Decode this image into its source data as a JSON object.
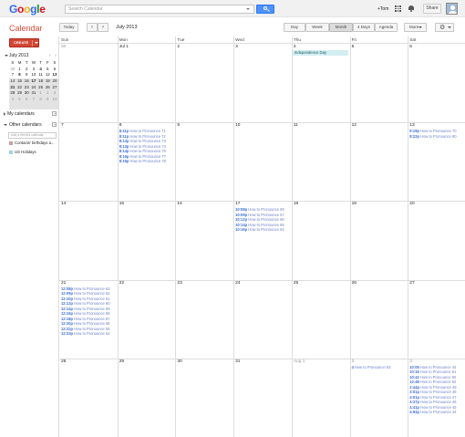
{
  "header": {
    "logo": [
      "G",
      "o",
      "o",
      "g",
      "l",
      "e"
    ],
    "logo_colors": [
      "#3369e8",
      "#d50f25",
      "#eeb211",
      "#3369e8",
      "#009925",
      "#d50f25"
    ],
    "search_placeholder": "Search Calendar",
    "user": "+Tom",
    "share_label": "Share"
  },
  "toolbar": {
    "app_title": "Calendar",
    "today_label": "Today",
    "prev_icon": "‹",
    "next_icon": "›",
    "date_range": "July 2013",
    "view_day": "Day",
    "view_week": "Week",
    "view_month": "Month",
    "view_4days": "4 Days",
    "view_agenda": "Agenda",
    "more_label": "More"
  },
  "sidebar": {
    "create_label": "CREATE",
    "mini_title": "July 2013",
    "mini_prev": "‹",
    "mini_next": "›",
    "mini_dow": [
      "S",
      "M",
      "T",
      "W",
      "T",
      "F",
      "S"
    ],
    "mini_weeks": [
      [
        "30",
        "1",
        "2",
        "3",
        "4",
        "5",
        "6"
      ],
      [
        "7",
        "8",
        "9",
        "10",
        "11",
        "12",
        "13"
      ],
      [
        "14",
        "15",
        "16",
        "17",
        "18",
        "19",
        "20"
      ],
      [
        "21",
        "22",
        "23",
        "24",
        "25",
        "26",
        "27"
      ],
      [
        "28",
        "29",
        "30",
        "31",
        "1",
        "2",
        "3"
      ],
      [
        "4",
        "5",
        "6",
        "7",
        "8",
        "9",
        "10"
      ]
    ],
    "my_calendars": "My calendars",
    "other_calendars": "Other calendars",
    "add_friend_placeholder": "Add a friend's calendar",
    "calendars": [
      {
        "name": "Contacts' birthdays a...",
        "color": "#c7a0a0"
      },
      {
        "name": "US Holidays",
        "color": "#9fd4e3"
      }
    ]
  },
  "month": {
    "dow": [
      "Sun",
      "Mon",
      "Tue",
      "Wed",
      "Thu",
      "Fri",
      "Sat"
    ],
    "weeks": [
      [
        {
          "day": "30",
          "other": true,
          "events": []
        },
        {
          "day": "Jul 1",
          "events": []
        },
        {
          "day": "2",
          "events": []
        },
        {
          "day": "3",
          "events": []
        },
        {
          "day": "4",
          "allday": "Independence Day",
          "events": []
        },
        {
          "day": "5",
          "events": []
        },
        {
          "day": "6",
          "events": []
        }
      ],
      [
        {
          "day": "7",
          "events": []
        },
        {
          "day": "8",
          "events": [
            {
              "time": "8:11p",
              "title": "How to Pronounce 71"
            },
            {
              "time": "8:11p",
              "title": "How to Pronounce 72"
            },
            {
              "time": "8:12p",
              "title": "How to Pronounce 73"
            },
            {
              "time": "8:13p",
              "title": "How to Pronounce 74"
            },
            {
              "time": "8:14p",
              "title": "How to Pronounce 75"
            },
            {
              "time": "8:15p",
              "title": "How to Pronounce 77"
            },
            {
              "time": "8:16p",
              "title": "How to Pronounce 78"
            }
          ]
        },
        {
          "day": "9",
          "events": []
        },
        {
          "day": "10",
          "events": []
        },
        {
          "day": "11",
          "events": []
        },
        {
          "day": "12",
          "events": []
        },
        {
          "day": "13",
          "events": [
            {
              "time": "8:19p",
              "title": "How to Pronounce 70"
            },
            {
              "time": "8:22p",
              "title": "How to Pronounce 80"
            }
          ]
        }
      ],
      [
        {
          "day": "14",
          "events": []
        },
        {
          "day": "15",
          "events": []
        },
        {
          "day": "16",
          "events": []
        },
        {
          "day": "17",
          "events": [
            {
              "time": "10:08p",
              "title": "How to Pronounce 68"
            },
            {
              "time": "10:09p",
              "title": "How to Pronounce 67"
            },
            {
              "time": "10:12p",
              "title": "How to Pronounce 66"
            },
            {
              "time": "10:14p",
              "title": "How to Pronounce 65"
            },
            {
              "time": "10:16p",
              "title": "How to Pronounce 64"
            }
          ]
        },
        {
          "day": "18",
          "events": []
        },
        {
          "day": "19",
          "events": []
        },
        {
          "day": "20",
          "events": []
        }
      ],
      [
        {
          "day": "21",
          "events": [
            {
              "time": "12:08p",
              "title": "How to Pronounce 63"
            },
            {
              "time": "12:09p",
              "title": "How to Pronounce 62"
            },
            {
              "time": "12:10p",
              "title": "How to Pronounce 61"
            },
            {
              "time": "12:12p",
              "title": "How to Pronounce 60"
            },
            {
              "time": "12:14p",
              "title": "How to Pronounce 59"
            },
            {
              "time": "12:16p",
              "title": "How to Pronounce 58"
            },
            {
              "time": "12:18p",
              "title": "How to Pronounce 57"
            },
            {
              "time": "12:20p",
              "title": "How to Pronounce 56"
            },
            {
              "time": "12:22p",
              "title": "How to Pronounce 55"
            },
            {
              "time": "12:23p",
              "title": "How to Pronounce 54"
            }
          ]
        },
        {
          "day": "22",
          "events": []
        },
        {
          "day": "23",
          "events": []
        },
        {
          "day": "24",
          "events": []
        },
        {
          "day": "25",
          "events": []
        },
        {
          "day": "26",
          "events": []
        },
        {
          "day": "27",
          "events": []
        }
      ],
      [
        {
          "day": "28",
          "events": []
        },
        {
          "day": "29",
          "events": []
        },
        {
          "day": "30",
          "events": []
        },
        {
          "day": "31",
          "events": []
        },
        {
          "day": "Aug 1",
          "other": true,
          "events": []
        },
        {
          "day": "2",
          "other": true,
          "events": [
            {
              "time": "4",
              "title": "How to Pronounce 53"
            }
          ]
        },
        {
          "day": "3",
          "other": true,
          "events": [
            {
              "time": "10:05",
              "title": "How to Pronounce 44"
            },
            {
              "time": "10:15",
              "title": "How to Pronounce 51"
            },
            {
              "time": "10:42",
              "title": "How to Pronounce 50"
            },
            {
              "time": "12:48",
              "title": "How to Pronounce 52"
            },
            {
              "time": "2:44p",
              "title": "How to Pronounce 49"
            },
            {
              "time": "3:01p",
              "title": "How to Pronounce 48"
            },
            {
              "time": "4:01p",
              "title": "How to Pronounce 47"
            },
            {
              "time": "4:37p",
              "title": "How to Pronounce 46"
            },
            {
              "time": "4:41p",
              "title": "How to Pronounce 45"
            },
            {
              "time": "4:54p",
              "title": "How to Pronounce 44"
            }
          ]
        }
      ]
    ]
  }
}
